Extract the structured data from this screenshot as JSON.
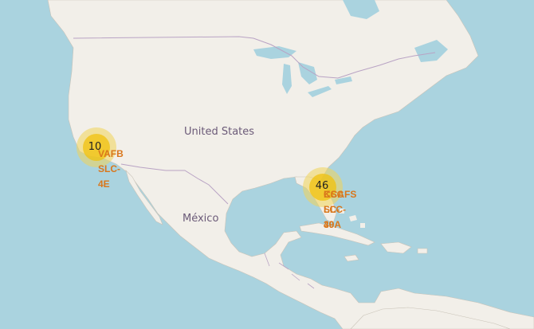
{
  "map": {
    "places": {
      "us": "United States",
      "mx": "México"
    },
    "clusters": [
      {
        "id": "west",
        "count": "10"
      },
      {
        "id": "east",
        "count": "46"
      }
    ],
    "sites": {
      "west": [
        "VAFB",
        "SLC-",
        "4E"
      ],
      "east_a": [
        "KSC",
        "LC-",
        "39A"
      ],
      "east_b": [
        "CCAFS",
        "SLC-",
        "40"
      ]
    }
  },
  "colors": {
    "water": "#aad3df",
    "land": "#f2efe9",
    "border": "#b9a3c4",
    "cluster_halo": "#f1d357",
    "cluster_core": "#f0c20c",
    "site_label": "#d9771c"
  }
}
